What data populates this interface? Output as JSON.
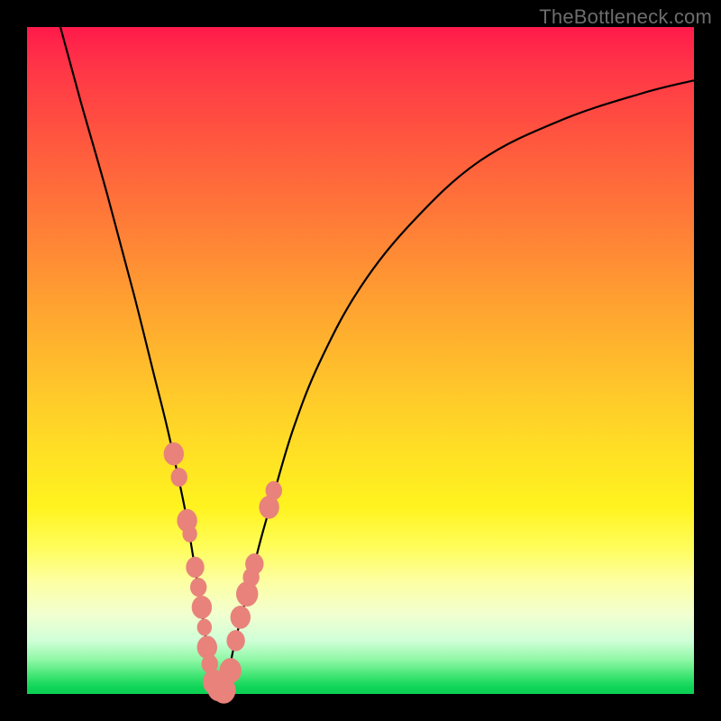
{
  "watermark": "TheBottleneck.com",
  "chart_data": {
    "type": "line",
    "title": "",
    "xlabel": "",
    "ylabel": "",
    "xlim": [
      0,
      100
    ],
    "ylim": [
      0,
      100
    ],
    "curve": {
      "x": [
        5,
        8,
        12,
        16,
        19,
        21,
        23,
        24,
        25,
        26,
        27,
        28,
        29,
        30,
        31,
        33,
        35,
        37,
        40,
        44,
        50,
        58,
        68,
        80,
        92,
        100
      ],
      "y": [
        100,
        89,
        75,
        60,
        48,
        40,
        31,
        26,
        20,
        14,
        7,
        2,
        0,
        2,
        7,
        15,
        23,
        30,
        40,
        50,
        61,
        71,
        80,
        86,
        90,
        92
      ]
    },
    "markers": {
      "x": [
        22.0,
        22.8,
        24.0,
        24.4,
        25.2,
        25.7,
        26.2,
        26.6,
        27.0,
        27.4,
        28.0,
        28.7,
        29.5,
        30.5,
        31.3,
        32.0,
        33.0,
        33.6,
        34.1,
        36.3,
        37.0
      ],
      "y": [
        36.0,
        32.5,
        26.0,
        24.0,
        19.0,
        16.0,
        13.0,
        10.0,
        7.0,
        4.5,
        1.8,
        0.8,
        0.6,
        3.5,
        8.0,
        11.5,
        15.0,
        17.5,
        19.5,
        28.0,
        30.5
      ]
    },
    "marker_radius": [
      11,
      9,
      11,
      8,
      10,
      9,
      11,
      8,
      11,
      9,
      12,
      12,
      13,
      12,
      10,
      11,
      12,
      9,
      10,
      11,
      9
    ]
  }
}
